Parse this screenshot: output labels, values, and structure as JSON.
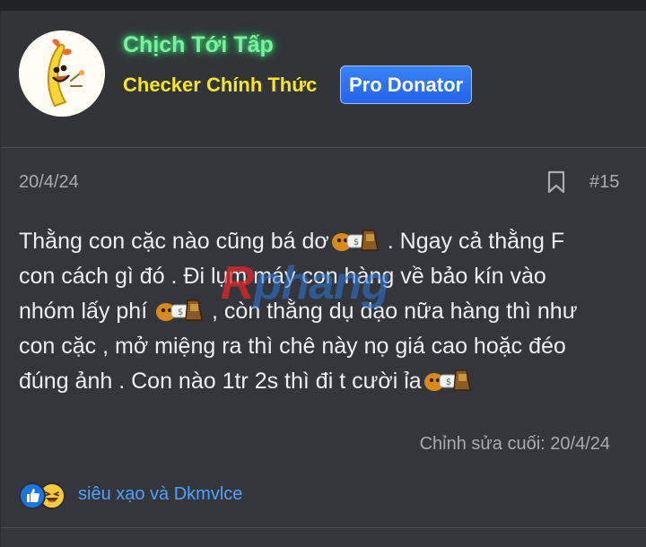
{
  "user": {
    "name": "Chịch Tới Tấp",
    "title": "Checker Chính Thức",
    "badge": "Pro Donator",
    "avatar_icon": "banana-mascot-icon"
  },
  "post": {
    "date": "20/4/24",
    "number": "#15",
    "bookmark_icon": "bookmark-icon",
    "lines": [
      {
        "text": "Thằng con cặc nào cũng bá dơ",
        "emoji": true,
        "tail": " . Ngay cả thằng F"
      },
      {
        "text": "con cách gì đó . Đi lụm máy con hàng về bảo kín vào",
        "emoji": false,
        "tail": ""
      },
      {
        "text": "nhóm lấy phí ",
        "emoji": true,
        "tail": " , còn thằng dụ dạo nữa hàng thì như"
      },
      {
        "text": "con cặc , mở miệng ra thì chê này nọ giá cao hoặc đéo",
        "emoji": false,
        "tail": ""
      },
      {
        "text": "đúng ảnh . Con nào 1tr 2s thì đi t cười ỉa",
        "emoji": true,
        "tail": ""
      }
    ],
    "emoji_icon": "moneybag-emoji-icon",
    "edited": "Chỉnh sửa cuối: 20/4/24"
  },
  "watermark": {
    "red": "R",
    "blue": "phang"
  },
  "reactions": {
    "icons": [
      "like-icon",
      "haha-icon"
    ],
    "users": "siêu xạo và Dkmvlce"
  },
  "colors": {
    "username": "#7df0a0",
    "title": "#f6e71f",
    "badge": "#2f74f2",
    "link": "#4ea1ff"
  }
}
